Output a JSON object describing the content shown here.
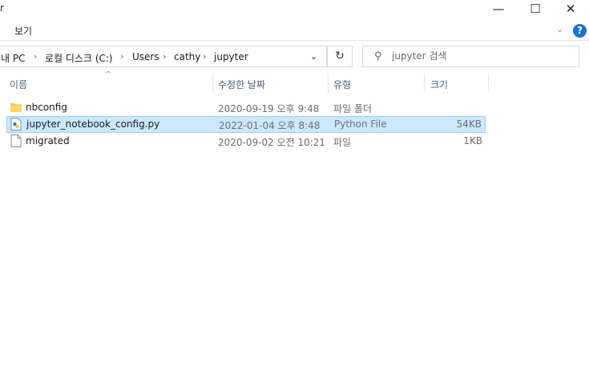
{
  "window": {
    "title": "r",
    "controls": {
      "minimize": "—",
      "maximize": "☐",
      "close": "✕"
    }
  },
  "ribbon": {
    "view_tab": "보기",
    "collapse": "⌄",
    "help": "?"
  },
  "address": {
    "crumbs": [
      "내 PC",
      "로컬 디스크 (C:)",
      "Users",
      "cathy",
      "jupyter"
    ],
    "separator": "›",
    "dropdown": "⌄",
    "refresh": "↻"
  },
  "search": {
    "placeholder": "jupyter 검색",
    "icon": "search-icon"
  },
  "columns": {
    "name": "이름",
    "date": "수정한 날짜",
    "type": "유형",
    "size": "크기",
    "sort": "^"
  },
  "files": [
    {
      "name": "nbconfig",
      "date": "2020-09-19 오후 9:48",
      "type": "파일 폴더",
      "size": "",
      "icon": "folder-icon",
      "selected": false
    },
    {
      "name": "jupyter_notebook_config.py",
      "date": "2022-01-04 오후 8:48",
      "type": "Python File",
      "size": "54KB",
      "icon": "python-file-icon",
      "selected": true
    },
    {
      "name": "migrated",
      "date": "2020-09-02 오전 10:21",
      "type": "파일",
      "size": "1KB",
      "icon": "file-icon",
      "selected": false
    }
  ],
  "colors": {
    "selection_bg": "#cce8ff",
    "selection_border": "#99d1ff",
    "folder": "#f5c542",
    "accent": "#1a6fd6"
  }
}
